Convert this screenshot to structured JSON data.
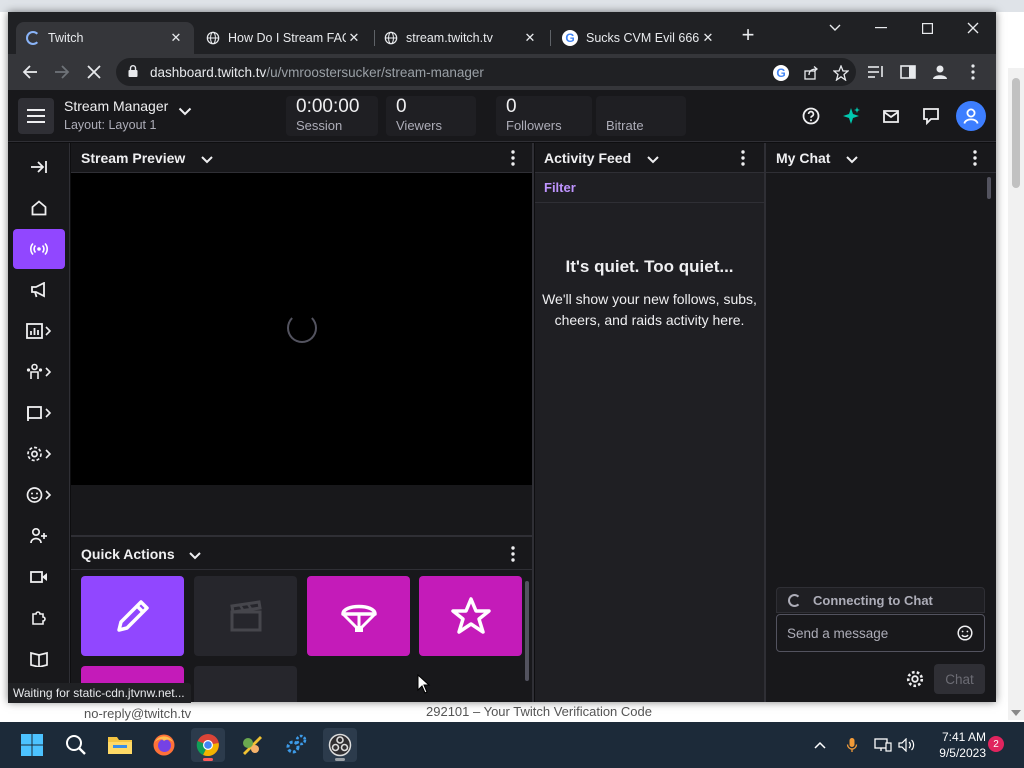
{
  "browser": {
    "tabs": [
      {
        "title": "Twitch",
        "favicon": "spinner-icon",
        "active": true
      },
      {
        "title": "How Do I Stream FAQ",
        "favicon": "globe-icon",
        "active": false
      },
      {
        "title": "stream.twitch.tv",
        "favicon": "globe-icon",
        "active": false
      },
      {
        "title": "Sucks CVM Evil 666 -",
        "favicon": "google-icon",
        "active": false
      }
    ],
    "url_host": "dashboard.twitch.tv",
    "url_path": "/u/vmroostersucker/stream-manager",
    "status_text": "Waiting for static-cdn.jtvnw.net..."
  },
  "background_page": {
    "sender": "no-reply@twitch.tv",
    "subject": "292101 – Your Twitch Verification Code"
  },
  "header": {
    "title": "Stream Manager",
    "layout": "Layout: Layout 1",
    "stats": [
      {
        "value": "0:00:00",
        "label": "Session"
      },
      {
        "value": "0",
        "label": "Viewers"
      },
      {
        "value": "0",
        "label": "Followers"
      },
      {
        "value": "",
        "label": "Bitrate"
      }
    ]
  },
  "left_nav": [
    "collapse-icon",
    "home-icon",
    "broadcast-icon",
    "megaphone-icon",
    "analytics-icon",
    "community-icon",
    "content-icon",
    "settings-icon",
    "emote-icon",
    "add-friend-icon",
    "video-icon",
    "extensions-icon",
    "book-icon"
  ],
  "panels": {
    "preview": {
      "title": "Stream Preview"
    },
    "quick_actions": {
      "title": "Quick Actions"
    },
    "activity": {
      "title": "Activity Feed",
      "filter": "Filter",
      "empty_title": "It's quiet. Too quiet...",
      "empty_text": "We'll show your new follows, subs, cheers, and raids activity here."
    },
    "chat": {
      "title": "My Chat",
      "connecting": "Connecting to Chat",
      "placeholder": "Send a message",
      "send_label": "Chat"
    }
  },
  "taskbar": {
    "time": "7:41 AM",
    "date": "9/5/2023",
    "notifications": "2"
  },
  "colors": {
    "twitch_purple": "#9147ff",
    "quick_action_magenta": "#c41bb9",
    "link_purple": "#bf94ff",
    "panel_bg": "#18181b"
  }
}
